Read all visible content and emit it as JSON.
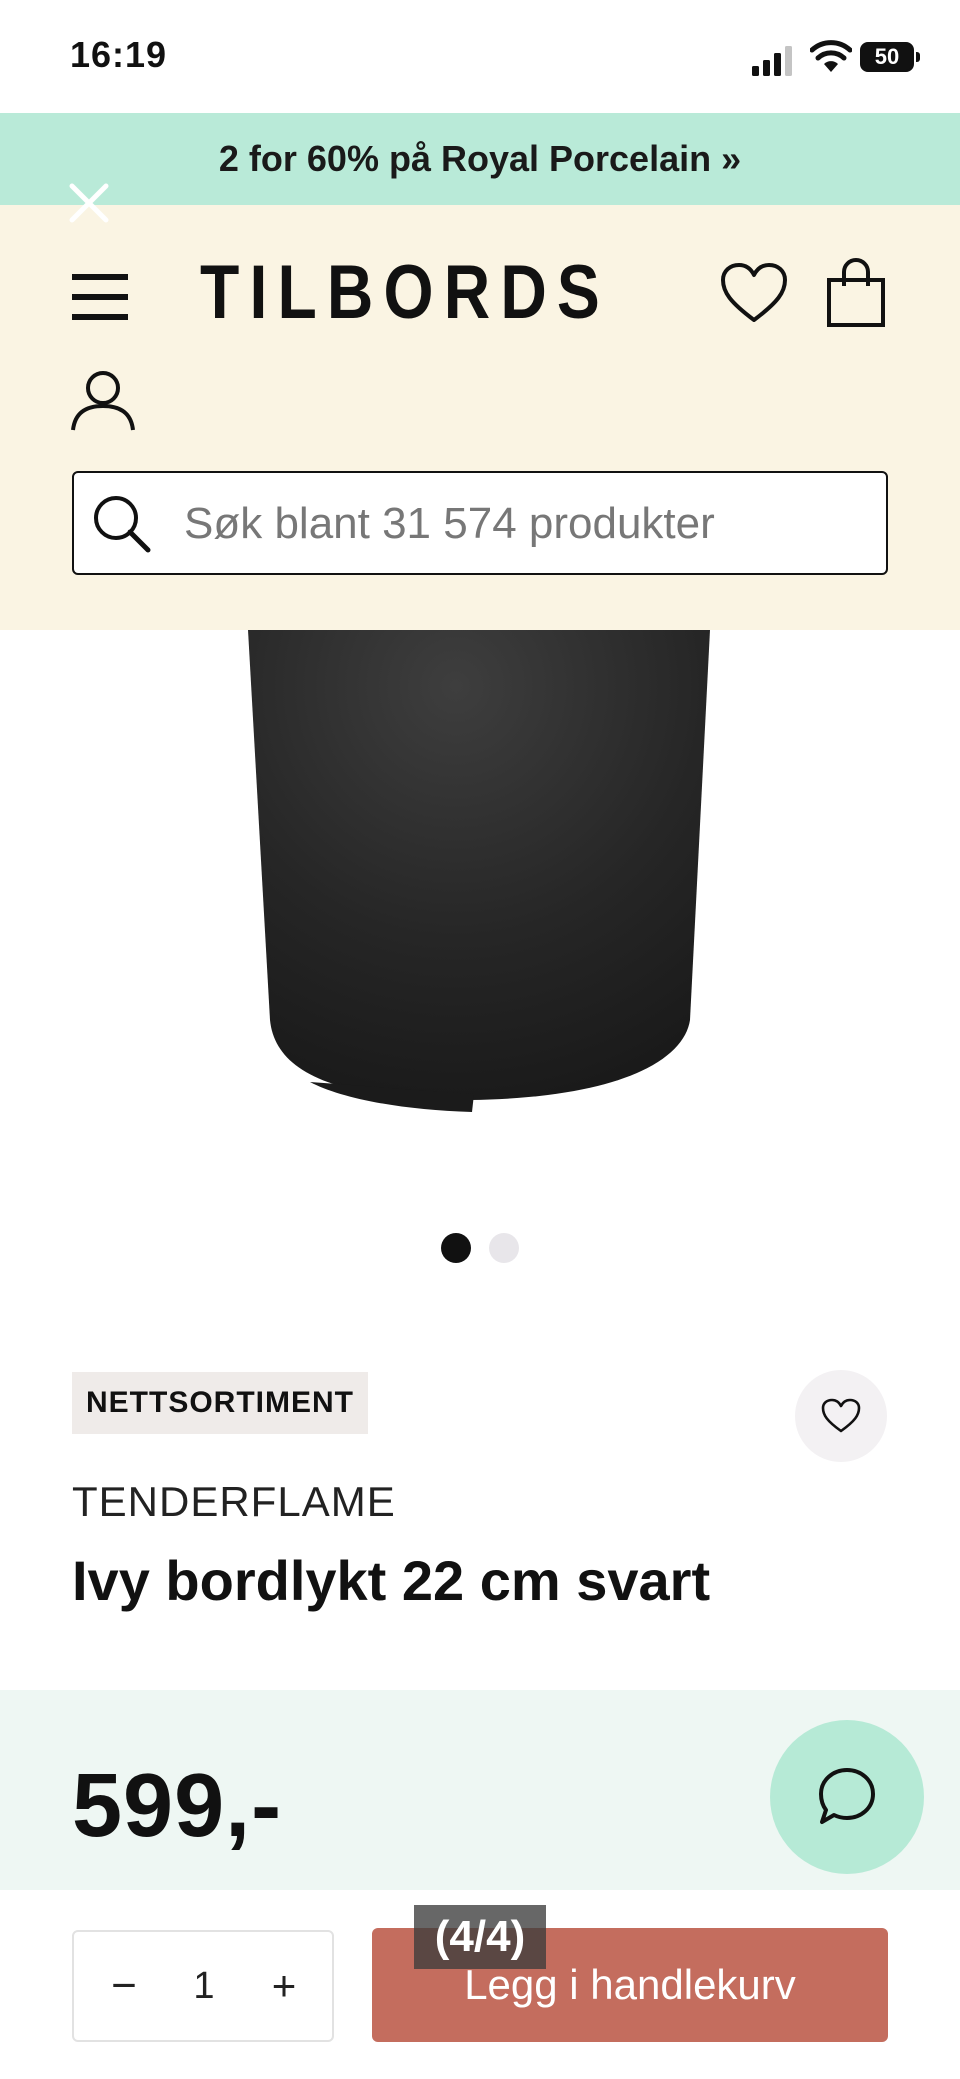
{
  "status_bar": {
    "time": "16:19",
    "battery": "50"
  },
  "promo": {
    "text": "2 for 60% på Royal Porcelain »"
  },
  "header": {
    "logo": "TILBORDS",
    "search_placeholder": "Søk blant 31 574 produkter"
  },
  "gallery": {
    "total_images": 2,
    "active_index": 0
  },
  "product": {
    "badge": "NETTSORTIMENT",
    "brand": "TENDERFLAME",
    "title": "Ivy bordlykt 22 cm svart",
    "price": "599,-"
  },
  "cart": {
    "minus": "−",
    "quantity": "1",
    "plus": "+",
    "add_label": "Legg i handlekurv"
  },
  "overlay": {
    "page_indicator": "(4/4)"
  },
  "colors": {
    "promo_bg": "#b9ead8",
    "header_bg": "#faf4e3",
    "price_band_bg": "#eef7f3",
    "add_button": "#c46d5e",
    "chat_button": "#b6ead6"
  },
  "icons": [
    "close-icon",
    "menu-icon",
    "heart-icon",
    "shopping-bag-icon",
    "user-icon",
    "search-icon",
    "chat-icon"
  ]
}
